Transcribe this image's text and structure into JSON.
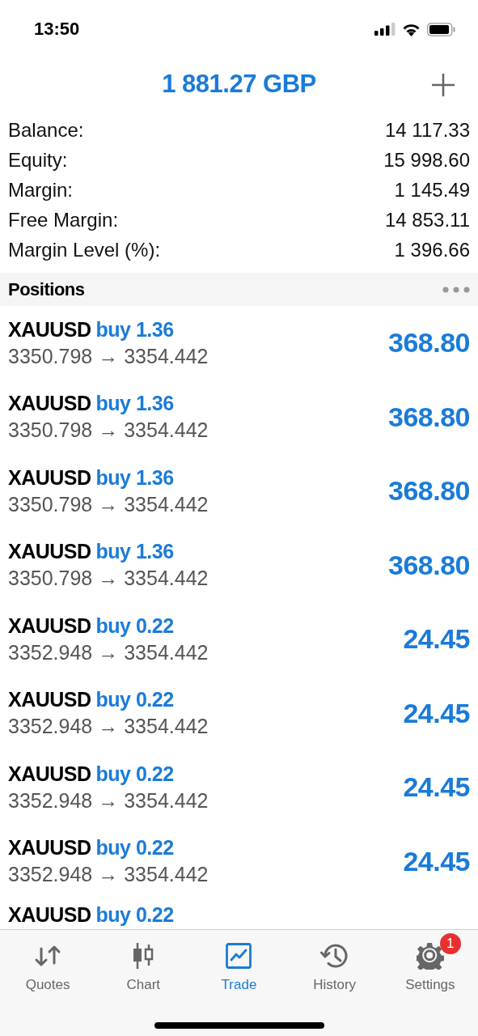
{
  "status_bar": {
    "time": "13:50"
  },
  "header": {
    "title": "1 881.27 GBP"
  },
  "summary": [
    {
      "label": "Balance:",
      "value": "14 117.33"
    },
    {
      "label": "Equity:",
      "value": "15 998.60"
    },
    {
      "label": "Margin:",
      "value": "1 145.49"
    },
    {
      "label": "Free Margin:",
      "value": "14 853.11"
    },
    {
      "label": "Margin Level (%):",
      "value": "1 396.66"
    }
  ],
  "positions": {
    "title": "Positions",
    "rows": [
      {
        "symbol": "XAUUSD",
        "trade": "buy 1.36",
        "prices": "3350.798 → 3354.442",
        "profit": "368.80"
      },
      {
        "symbol": "XAUUSD",
        "trade": "buy 1.36",
        "prices": "3350.798 → 3354.442",
        "profit": "368.80"
      },
      {
        "symbol": "XAUUSD",
        "trade": "buy 1.36",
        "prices": "3350.798 → 3354.442",
        "profit": "368.80"
      },
      {
        "symbol": "XAUUSD",
        "trade": "buy 1.36",
        "prices": "3350.798 → 3354.442",
        "profit": "368.80"
      },
      {
        "symbol": "XAUUSD",
        "trade": "buy 0.22",
        "prices": "3352.948 → 3354.442",
        "profit": "24.45"
      },
      {
        "symbol": "XAUUSD",
        "trade": "buy 0.22",
        "prices": "3352.948 → 3354.442",
        "profit": "24.45"
      },
      {
        "symbol": "XAUUSD",
        "trade": "buy 0.22",
        "prices": "3352.948 → 3354.442",
        "profit": "24.45"
      },
      {
        "symbol": "XAUUSD",
        "trade": "buy 0.22",
        "prices": "3352.948 → 3354.442",
        "profit": "24.45"
      },
      {
        "symbol": "XAUUSD",
        "trade": "buy 0.22"
      }
    ]
  },
  "tab_bar": [
    {
      "kind": "quotes",
      "label": "Quotes",
      "selected": false
    },
    {
      "kind": "chart",
      "label": "Chart",
      "selected": false
    },
    {
      "kind": "trade",
      "label": "Trade",
      "selected": true
    },
    {
      "kind": "history",
      "label": "History",
      "selected": false
    },
    {
      "kind": "settings",
      "label": "Settings",
      "selected": false,
      "badge": "1"
    }
  ]
}
